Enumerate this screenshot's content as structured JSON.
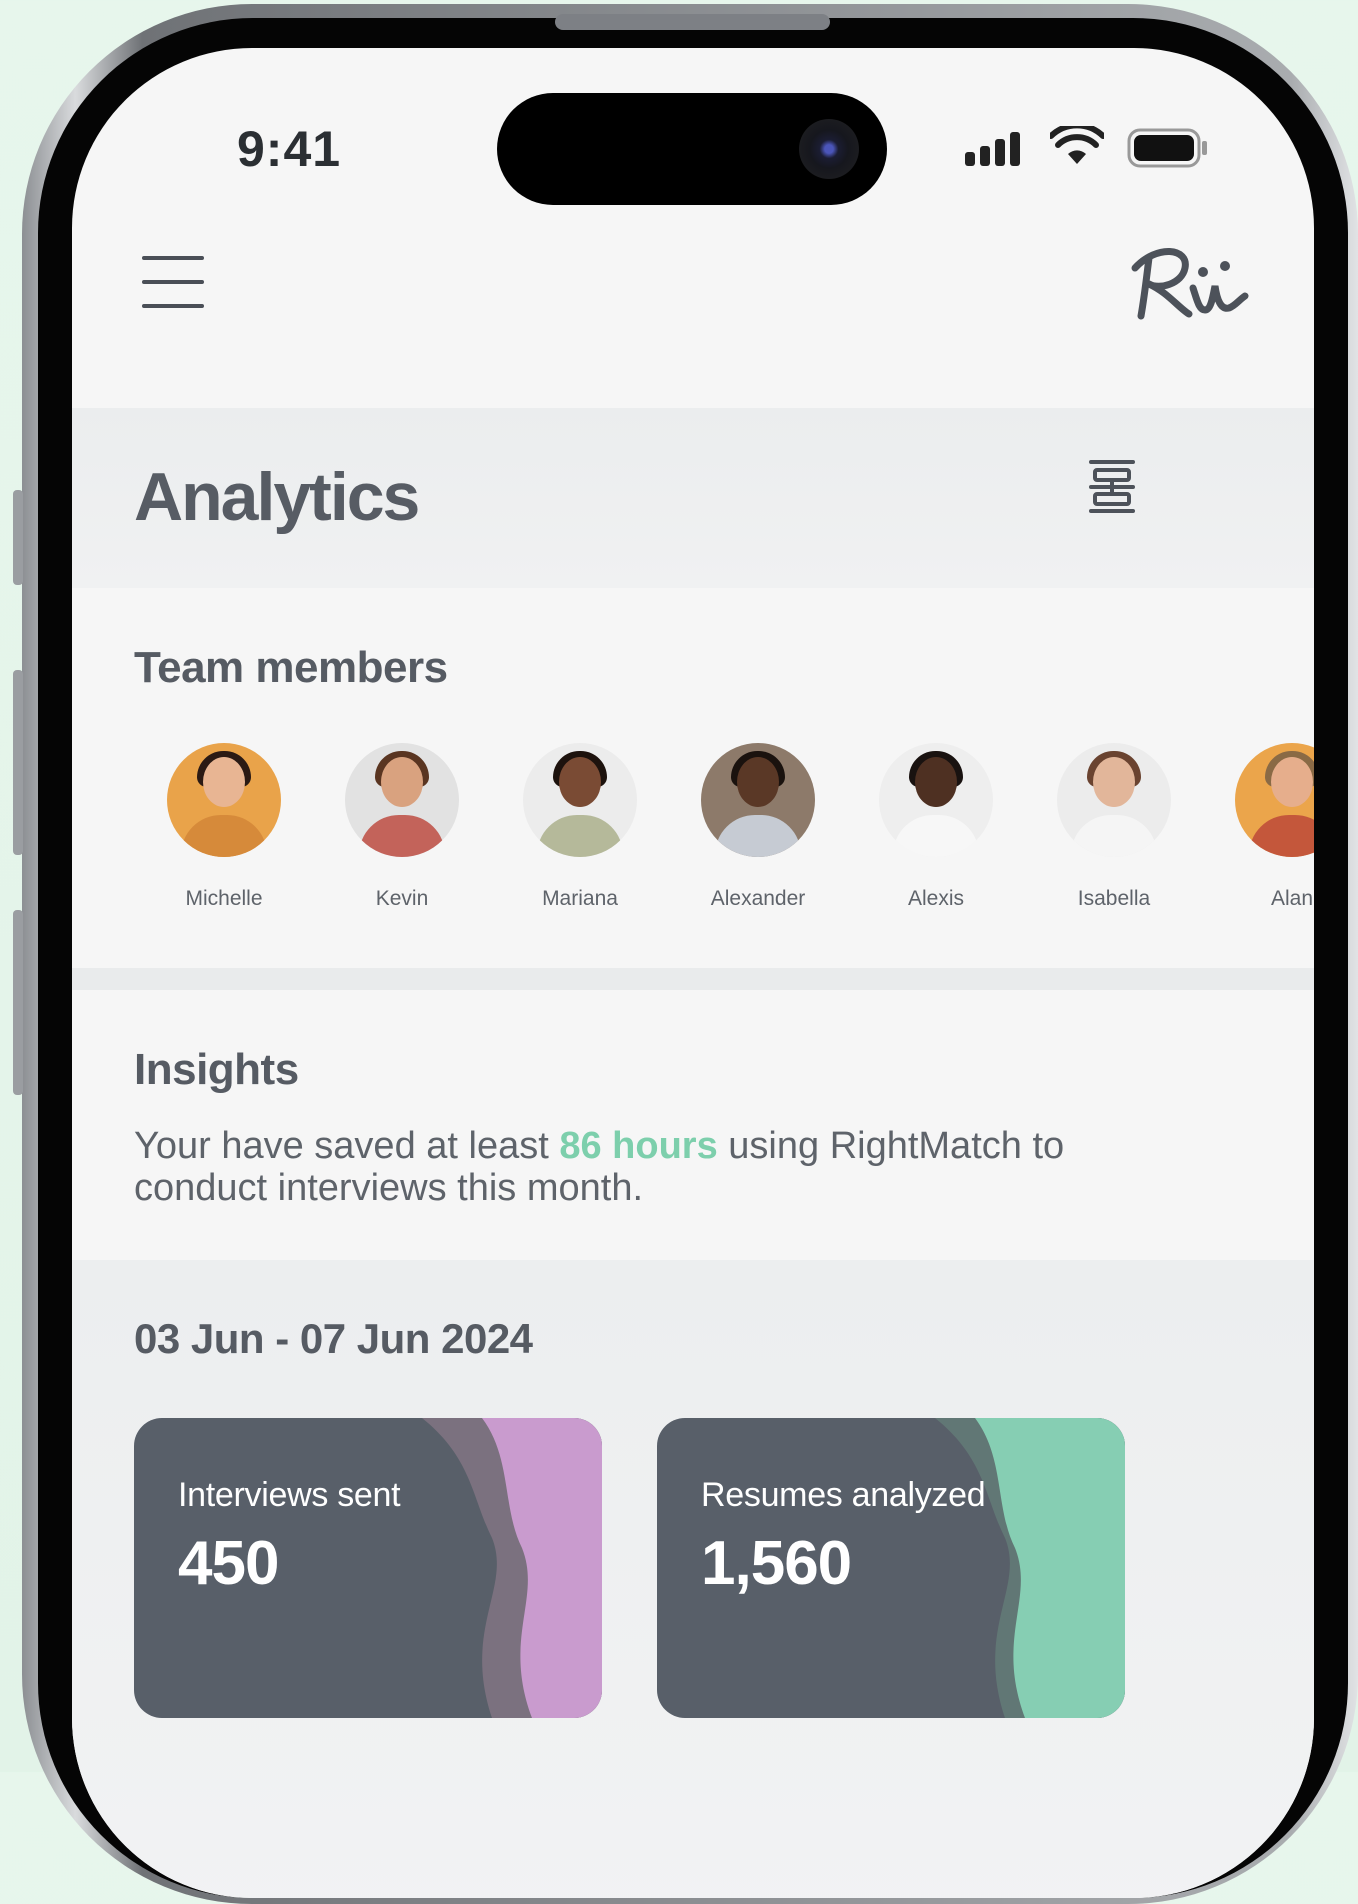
{
  "status_bar": {
    "time": "9:41"
  },
  "header": {
    "logo_text": "Rii"
  },
  "page": {
    "title": "Analytics"
  },
  "team": {
    "title": "Team members",
    "members": [
      {
        "name": "Michelle",
        "bg": "#e9a34a",
        "skin": "#e8b593",
        "hair": "#2b1a14",
        "shirt": "#d68a3a"
      },
      {
        "name": "Kevin",
        "bg": "#e2e2e2",
        "skin": "#d9a27f",
        "hair": "#5a3521",
        "shirt": "#c3635a"
      },
      {
        "name": "Mariana",
        "bg": "#ececec",
        "skin": "#7a4b34",
        "hair": "#1d120d",
        "shirt": "#b5b99a"
      },
      {
        "name": "Alexander",
        "bg": "#8d7a6a",
        "skin": "#5a3826",
        "hair": "#1a120e",
        "shirt": "#c6cbd3"
      },
      {
        "name": "Alexis",
        "bg": "#eeeeee",
        "skin": "#4e3022",
        "hair": "#191210",
        "shirt": "#f7f7f7"
      },
      {
        "name": "Isabella",
        "bg": "#ececec",
        "skin": "#e2b69a",
        "hair": "#6a4330",
        "shirt": "#f5f5f5"
      },
      {
        "name": "Alan",
        "bg": "#eba54b",
        "skin": "#e6ae8c",
        "hair": "#8a6a45",
        "shirt": "#c4573b"
      }
    ]
  },
  "insights": {
    "title": "Insights",
    "text_before": "Your have saved at least ",
    "highlight": "86 hours",
    "text_after": " using RightMatch to conduct interviews this month.",
    "highlight_color": "#7dcfac"
  },
  "stats": {
    "date_range": "03 Jun - 07 Jun 2024",
    "cards": [
      {
        "label": "Interviews sent",
        "value": "450",
        "accent": "#c99bce",
        "mid": "#7b717f"
      },
      {
        "label": "Resumes analyzed",
        "value": "1,560",
        "accent": "#86ceb3",
        "mid": "#617775"
      }
    ]
  }
}
